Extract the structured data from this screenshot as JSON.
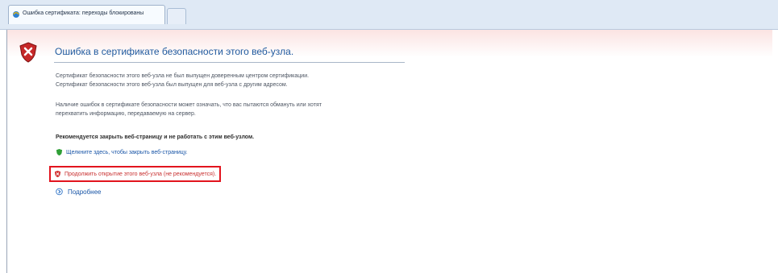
{
  "tab": {
    "title": "Ошибка сертификата: переходы блокированы"
  },
  "page": {
    "heading": "Ошибка в сертификате безопасности этого веб-узла.",
    "paragraph1_line1": "Сертификат безопасности этого веб-узла не был выпущен доверенным центром сертификации.",
    "paragraph1_line2": "Сертификат безопасности этого веб-узла был выпущен для веб-узла с другим адресом.",
    "paragraph2_line1": "Наличие ошибок в сертификате безопасности может означать, что вас пытаются обмануть или хотят",
    "paragraph2_line2": "перехватить информацию, передаваемую на сервер.",
    "recommendation": "Рекомендуется закрыть веб-страницу и не работать с этим веб-узлом.",
    "close_link": "Щелкните здесь, чтобы закрыть веб-страницу.",
    "continue_link": "Продолжить открытие этого веб-узла (не рекомендуется).",
    "more_info": "Подробнее"
  },
  "colors": {
    "heading": "#1f5a9f",
    "link": "#1a56a7",
    "warning_link": "#c83030",
    "highlight_box": "#e2141e"
  }
}
